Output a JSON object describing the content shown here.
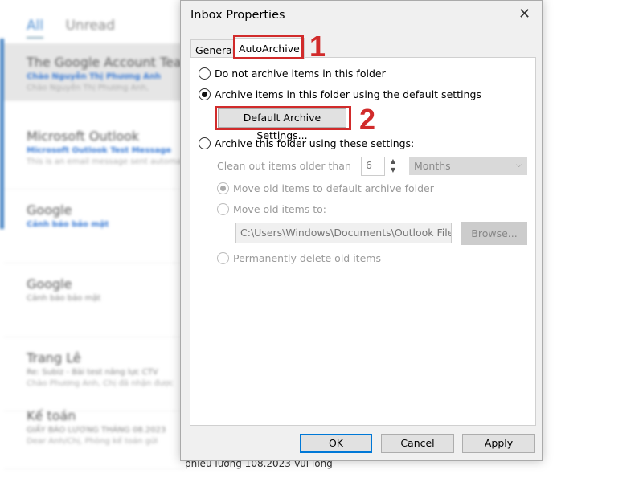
{
  "background": {
    "tabs": [
      "All",
      "Unread"
    ],
    "mails": [
      {
        "from": "The Google Account Team",
        "subject": "Chào Nguyễn Thị Phương Anh",
        "preview": "Chào Nguyễn Thị Phương Anh,"
      },
      {
        "from": "Microsoft Outlook",
        "subject": "Microsoft Outlook Test Message",
        "preview": "This is an email message sent automatically"
      },
      {
        "from": "Google",
        "subject": "Cảnh báo bảo mật",
        "preview": ""
      },
      {
        "from": "Google",
        "subject": "Cảnh báo bảo mật",
        "preview": ""
      },
      {
        "from": "Trang Lê",
        "subject": "Re: Subiz - Bài test năng lực CTV",
        "preview": "Chào Phương Anh, Chị đã nhận được"
      },
      {
        "from": "Kế toán",
        "subject": "GIẤY BÁO LƯƠNG THÁNG 08.2023",
        "preview": "Dear Anh/Chị, Phòng kế toán gửi"
      }
    ],
    "bottom_text": "phiếu lương 108.2023  Vui lòng"
  },
  "dialog": {
    "title": "Inbox Properties",
    "close_icon": "close-icon",
    "tabs": [
      "General",
      "AutoArchive"
    ],
    "options": {
      "no_archive": "Do not archive items in this folder",
      "default_archive": "Archive items in this folder using the default settings",
      "default_button": "Default Archive Settings...",
      "custom_archive": "Archive this folder using these settings:",
      "clean_label": "Clean out items older than",
      "clean_value": "6",
      "unit": "Months",
      "move_default": "Move old items to default archive folder",
      "move_to": "Move old items to:",
      "path": "C:\\Users\\Windows\\Documents\\Outlook Files\\",
      "browse": "Browse...",
      "delete": "Permanently delete old items"
    },
    "selected_option": "default_archive",
    "buttons": {
      "ok": "OK",
      "cancel": "Cancel",
      "apply": "Apply"
    }
  },
  "annotations": {
    "one": "1",
    "two": "2",
    "color": "#d12b2b"
  }
}
